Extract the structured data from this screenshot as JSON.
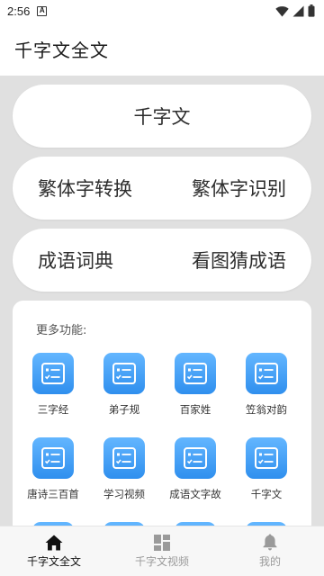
{
  "status_bar": {
    "time": "2:56",
    "notification_letter": "A"
  },
  "app_bar": {
    "title": "千字文全文"
  },
  "feature_buttons": {
    "qianziwen": "千字文",
    "traditional_convert": "繁体字转换",
    "traditional_recognize": "繁体字识别",
    "idiom_dictionary": "成语词典",
    "guess_idiom": "看图猜成语"
  },
  "more_section": {
    "label": "更多功能:",
    "items": [
      {
        "label": "三字经",
        "icon": "checklist-icon"
      },
      {
        "label": "弟子规",
        "icon": "checklist-icon"
      },
      {
        "label": "百家姓",
        "icon": "checklist-icon"
      },
      {
        "label": "笠翁对韵",
        "icon": "checklist-icon"
      },
      {
        "label": "唐诗三百首",
        "icon": "checklist-icon"
      },
      {
        "label": "学习视频",
        "icon": "checklist-icon"
      },
      {
        "label": "成语文字故",
        "icon": "checklist-icon"
      },
      {
        "label": "千字文",
        "icon": "checklist-icon"
      }
    ]
  },
  "bottom_nav": {
    "items": [
      {
        "label": "千字文全文",
        "icon": "home-icon",
        "active": true
      },
      {
        "label": "千字文视频",
        "icon": "grid-icon",
        "active": false
      },
      {
        "label": "我的",
        "icon": "bell-icon",
        "active": false
      }
    ]
  },
  "colors": {
    "accent": "#3a9af2",
    "background": "#e0e0e0",
    "surface": "#ffffff"
  }
}
